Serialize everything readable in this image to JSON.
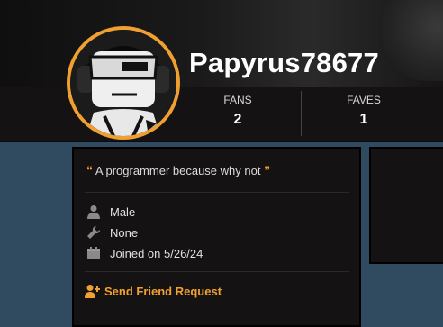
{
  "profile": {
    "username": "Papyrus78677",
    "stats": [
      {
        "label": "FANS",
        "value": "2"
      },
      {
        "label": "FAVES",
        "value": "1"
      }
    ]
  },
  "about": {
    "bio_open_quote": "“",
    "bio": "A programmer because why not",
    "bio_close_quote": "”",
    "gender": "Male",
    "occupation": "None",
    "joined": "Joined on 5/26/24",
    "friend_request": "Send Friend Request"
  },
  "icons": [
    "user-icon",
    "wrench-icon",
    "calendar-icon",
    "user-plus-icon",
    "quote-icon"
  ],
  "colors": {
    "accent": "#f0a030",
    "page_bg": "#304b60",
    "panel_bg": "#151213"
  }
}
